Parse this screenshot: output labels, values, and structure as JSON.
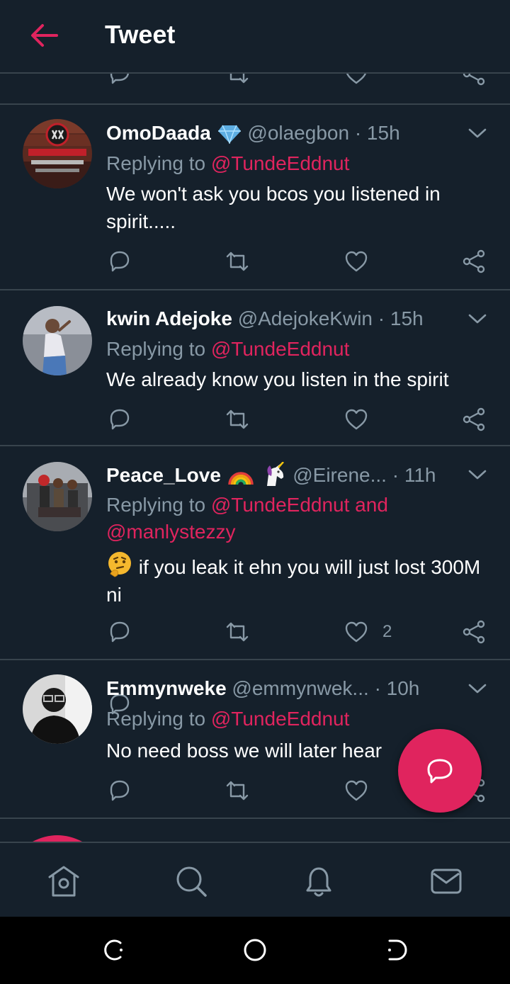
{
  "header": {
    "title": "Tweet"
  },
  "tweets": [
    {
      "name": "OmoDaada",
      "handle": "@olaegbon",
      "time": "· 15h",
      "reply_label": "Replying to",
      "reply_mentions": "@TundeEddnut",
      "text": "We won't ask you bcos you listened in spirit.....",
      "likes": ""
    },
    {
      "name": "kwin Adejoke",
      "handle": "@AdejokeKwin",
      "time": "· 15h",
      "reply_label": "Replying to",
      "reply_mentions": "@TundeEddnut",
      "text": "We already know you listen in the spirit",
      "likes": ""
    },
    {
      "name": "Peace_Love",
      "handle": "@Eirene...",
      "time": "· 11h",
      "reply_label": "Replying to",
      "reply_mentions": "@TundeEddnut and @manlystezzy",
      "text": "if you leak it ehn you will just lost 300M ni",
      "likes": "2"
    },
    {
      "name": "Emmynweke",
      "handle": "@emmynwek...",
      "time": "· 10h",
      "reply_label": "Replying to",
      "reply_mentions": "@TundeEddnut",
      "text": "No need boss we will later hear",
      "likes": ""
    }
  ],
  "icons": {
    "back": "back-arrow-icon",
    "reply": "reply-icon",
    "retweet": "retweet-icon",
    "like": "heart-icon",
    "share": "share-icon",
    "compose": "compose-reply-icon",
    "tabs": [
      "home-icon",
      "search-icon",
      "notifications-icon",
      "messages-icon"
    ]
  },
  "colors": {
    "background": "#15202b",
    "accent": "#e0245e",
    "secondary_text": "#8899a6",
    "divider": "#38444d"
  }
}
